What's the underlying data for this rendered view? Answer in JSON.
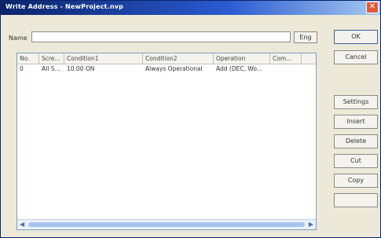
{
  "window": {
    "title": "Write Address - NewProject.nvp"
  },
  "name_field": {
    "label": "Name",
    "value": "",
    "lang_button": "Eng"
  },
  "list": {
    "columns": [
      "No.",
      "Scre...",
      "Condition1",
      "Condition2",
      "Operation",
      "Com..."
    ],
    "rows": [
      {
        "no": "0",
        "screen": "All S...",
        "condition1": "10.00 ON",
        "condition2": "Always Operational",
        "operation": "Add (DEC, Wo...",
        "comment": ""
      }
    ]
  },
  "buttons": {
    "ok": "OK",
    "cancel": "Cancel",
    "settings": "Settings",
    "insert": "Insert",
    "delete": "Delete",
    "cut": "Cut",
    "copy": "Copy",
    "empty": ""
  },
  "colors": {
    "titlebar": "#0a246a",
    "close": "#e05a3a"
  }
}
